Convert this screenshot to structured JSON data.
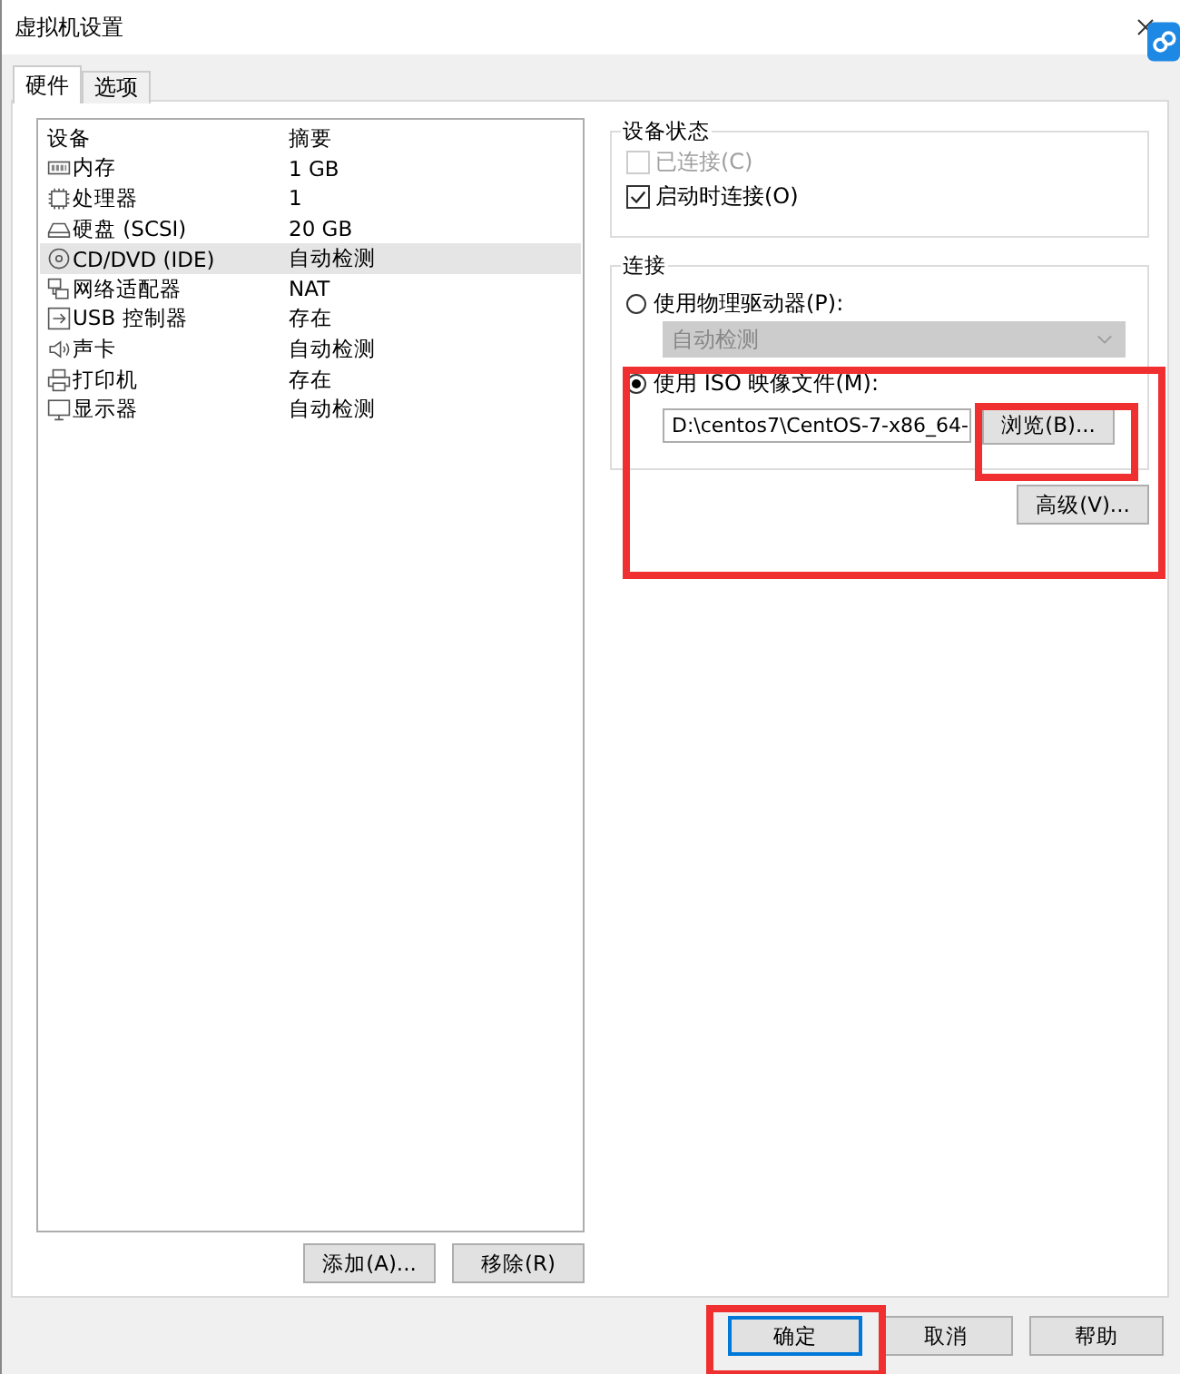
{
  "window": {
    "title": "虚拟机设置"
  },
  "tabs": [
    {
      "label": "硬件",
      "selected": true
    },
    {
      "label": "选项",
      "selected": false
    }
  ],
  "devices": {
    "columns": [
      "设备",
      "摘要"
    ],
    "rows": [
      {
        "kind": "memory",
        "name": "内存",
        "summary": "1 GB",
        "selected": false
      },
      {
        "kind": "cpu",
        "name": "处理器",
        "summary": "1",
        "selected": false
      },
      {
        "kind": "disk",
        "name": "硬盘 (SCSI)",
        "summary": "20 GB",
        "selected": false
      },
      {
        "kind": "cd",
        "name": "CD/DVD (IDE)",
        "summary": "自动检测",
        "selected": true
      },
      {
        "kind": "network",
        "name": "网络适配器",
        "summary": "NAT",
        "selected": false
      },
      {
        "kind": "usb",
        "name": "USB 控制器",
        "summary": "存在",
        "selected": false
      },
      {
        "kind": "sound",
        "name": "声卡",
        "summary": "自动检测",
        "selected": false
      },
      {
        "kind": "printer",
        "name": "打印机",
        "summary": "存在",
        "selected": false
      },
      {
        "kind": "display",
        "name": "显示器",
        "summary": "自动检测",
        "selected": false
      }
    ]
  },
  "list_buttons": [
    "添加(A)...",
    "移除(R)"
  ],
  "device_status": {
    "title": "设备状态",
    "checkboxes": [
      {
        "label": "已连接(C)",
        "checked": false,
        "disabled": true
      },
      {
        "label": "启动时连接(O)",
        "checked": true,
        "disabled": false
      }
    ]
  },
  "connection": {
    "title": "连接",
    "physical": {
      "label": "使用物理驱动器(P):",
      "selected": false,
      "dropdown": {
        "value": "自动检测",
        "disabled": true
      }
    },
    "iso": {
      "label": "使用 ISO 映像文件(M):",
      "selected": true,
      "path": "D:\\centos7\\CentOS-7-x86_64-",
      "browse": "浏览(B)..."
    },
    "advanced": "高级(V)..."
  },
  "dialog_buttons": [
    {
      "label": "确定",
      "selected": true
    },
    {
      "label": "取消",
      "selected": false
    },
    {
      "label": "帮助",
      "selected": false
    }
  ]
}
